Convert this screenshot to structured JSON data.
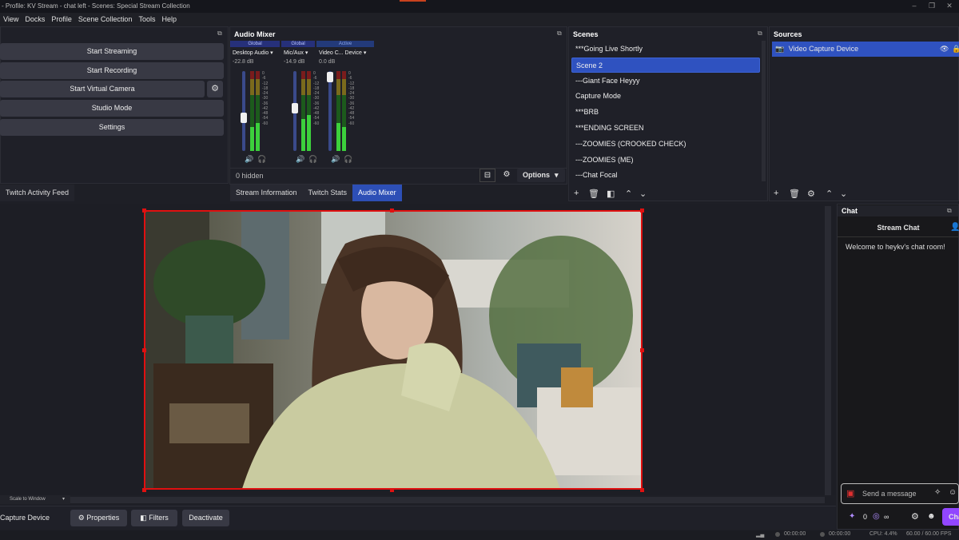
{
  "window": {
    "title": "- Profile: KV Stream - chat left - Scenes: Special Stream Collection"
  },
  "menu": [
    "View",
    "Docks",
    "Profile",
    "Scene Collection",
    "Tools",
    "Help"
  ],
  "controls": {
    "start_streaming": "Start Streaming",
    "start_recording": "Start Recording",
    "start_virtual_camera": "Start Virtual Camera",
    "studio_mode": "Studio Mode",
    "settings": "Settings"
  },
  "left_tab": "Twitch Activity Feed",
  "audio_mixer": {
    "title": "Audio Mixer",
    "channels": [
      {
        "badge": "Global",
        "name": "Desktop Audio",
        "db": "-22.8 dB",
        "level": 0.42,
        "badge_state": "global"
      },
      {
        "badge": "Global",
        "name": "Mic/Aux",
        "db": "-14.9 dB",
        "level": 0.54,
        "badge_state": "global"
      },
      {
        "badge": "Active",
        "name": "Video C... Device",
        "db": "0.0 dB",
        "level": 0.93,
        "badge_state": "active"
      }
    ],
    "meter_ticks": [
      "0",
      "-6",
      "-12",
      "-18",
      "-24",
      "-30",
      "-36",
      "-42",
      "-48",
      "-54",
      "-60"
    ],
    "hidden_label": "0 hidden",
    "options_label": "Options"
  },
  "middle_tabs": [
    "Stream Information",
    "Twitch Stats",
    "Audio Mixer"
  ],
  "scenes": {
    "title": "Scenes",
    "items": [
      "***Going Live Shortly",
      "Scene 2",
      "---Giant Face Heyyy",
      "Capture Mode",
      "***BRB",
      "***ENDING SCREEN",
      "---ZOOMIES (CROOKED CHECK)",
      "---ZOOMIES (ME)",
      "---Chat Focal"
    ],
    "selected": 1
  },
  "sources": {
    "title": "Sources",
    "items": [
      "Video Capture Device"
    ]
  },
  "chat": {
    "title": "Chat",
    "header": "Stream Chat",
    "welcome": "Welcome to heykv's chat room!",
    "placeholder": "Send a message",
    "points": "0",
    "infinity": "∞",
    "chat_btn": "Chat"
  },
  "preview": {
    "scale_label": "Scale to Window"
  },
  "source_bar": {
    "name": "Capture Device",
    "properties": "Properties",
    "filters": "Filters",
    "deactivate": "Deactivate"
  },
  "status": {
    "live_time": "00:00:00",
    "rec_time": "00:00:00",
    "cpu": "CPU: 4.4%",
    "fps": "60.00 / 60.00 FPS"
  },
  "colors": {
    "accent": "#2f52c0",
    "selection_border": "#e01010",
    "chat_button": "#9146ff"
  }
}
